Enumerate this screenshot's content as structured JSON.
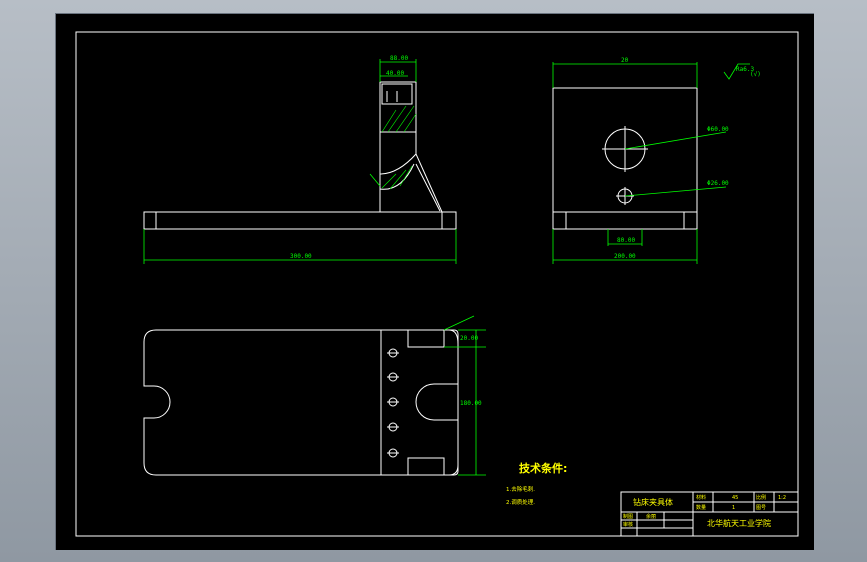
{
  "colors": {
    "background": "#000000",
    "line": "#ffffff",
    "dimension": "#00ff00",
    "text": "#ffff00",
    "outer_frame": "#9aa3ad"
  },
  "front_view": {
    "dim_total_width": "300.00",
    "dim_top_upright": "88.00",
    "dim_slot": "40.00"
  },
  "side_view": {
    "dim_top": "20",
    "dim_bottom": "200.00",
    "dim_inner": "80.00",
    "hole_large_label": "Φ60.00",
    "hole_small_label": "Φ26.00",
    "roughness": "Ra6.3",
    "roughness_note": "(√)"
  },
  "plan_view": {
    "dim_top": "20.00",
    "dim_height": "180.00"
  },
  "notes": {
    "title": "技术条件:",
    "items": [
      "1.去除毛刺.",
      "2.调质处理."
    ]
  },
  "title_block": {
    "drawing_name": "钻床夹具体",
    "material_label": "材料",
    "material_value": "45",
    "scale_label": "比例",
    "scale_value": "1:2",
    "quantity_label": "数量",
    "quantity_value": "1",
    "drawing_no_label": "图号",
    "drawn_label": "制图",
    "drawn_value": "余丽",
    "checked_label": "审核",
    "school": "北华航天工业学院"
  }
}
